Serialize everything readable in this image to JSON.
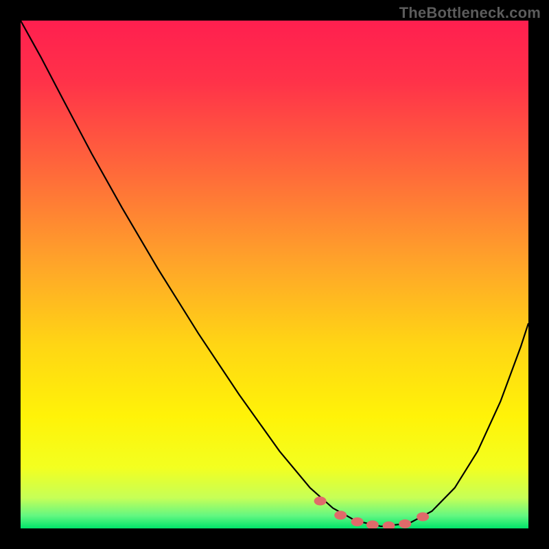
{
  "watermark": "TheBottleneck.com",
  "gradient_stops": [
    {
      "offset": 0.0,
      "color": "#ff1f4f"
    },
    {
      "offset": 0.12,
      "color": "#ff3249"
    },
    {
      "offset": 0.3,
      "color": "#ff6a3a"
    },
    {
      "offset": 0.48,
      "color": "#ffa529"
    },
    {
      "offset": 0.64,
      "color": "#ffd614"
    },
    {
      "offset": 0.78,
      "color": "#fff308"
    },
    {
      "offset": 0.88,
      "color": "#f3ff20"
    },
    {
      "offset": 0.94,
      "color": "#c6ff57"
    },
    {
      "offset": 0.975,
      "color": "#63f781"
    },
    {
      "offset": 1.0,
      "color": "#00e46a"
    }
  ],
  "curve": {
    "stroke": "#000000",
    "width": 2.2,
    "points": [
      [
        0.0,
        0.0
      ],
      [
        0.04,
        0.072
      ],
      [
        0.085,
        0.158
      ],
      [
        0.14,
        0.262
      ],
      [
        0.2,
        0.369
      ],
      [
        0.27,
        0.488
      ],
      [
        0.35,
        0.616
      ],
      [
        0.43,
        0.736
      ],
      [
        0.51,
        0.848
      ],
      [
        0.57,
        0.92
      ],
      [
        0.615,
        0.96
      ],
      [
        0.66,
        0.985
      ],
      [
        0.71,
        0.996
      ],
      [
        0.765,
        0.99
      ],
      [
        0.81,
        0.966
      ],
      [
        0.855,
        0.92
      ],
      [
        0.9,
        0.848
      ],
      [
        0.945,
        0.75
      ],
      [
        0.985,
        0.642
      ],
      [
        1.0,
        0.596
      ]
    ]
  },
  "dots": {
    "fill": "#e06a6a",
    "rx": 9,
    "ry": 6.5,
    "points": [
      [
        0.59,
        0.946
      ],
      [
        0.63,
        0.974
      ],
      [
        0.663,
        0.987
      ],
      [
        0.693,
        0.993
      ],
      [
        0.725,
        0.995
      ],
      [
        0.757,
        0.991
      ],
      [
        0.792,
        0.977
      ]
    ]
  },
  "chart_data": {
    "type": "line",
    "title": "",
    "xlabel": "",
    "ylabel": "",
    "xlim": [
      0,
      1
    ],
    "ylim": [
      0,
      1
    ],
    "series": [
      {
        "name": "bottleneck-curve",
        "x": [
          0.0,
          0.04,
          0.085,
          0.14,
          0.2,
          0.27,
          0.35,
          0.43,
          0.51,
          0.57,
          0.615,
          0.66,
          0.71,
          0.765,
          0.81,
          0.855,
          0.9,
          0.945,
          0.985,
          1.0
        ],
        "y": [
          1.0,
          0.928,
          0.842,
          0.738,
          0.631,
          0.512,
          0.384,
          0.264,
          0.152,
          0.08,
          0.04,
          0.015,
          0.004,
          0.01,
          0.034,
          0.08,
          0.152,
          0.25,
          0.358,
          0.404
        ]
      },
      {
        "name": "optimal-range-dots",
        "x": [
          0.59,
          0.63,
          0.663,
          0.693,
          0.725,
          0.757,
          0.792
        ],
        "y": [
          0.054,
          0.026,
          0.013,
          0.007,
          0.005,
          0.009,
          0.023
        ]
      }
    ],
    "annotations": [
      {
        "text": "TheBottleneck.com",
        "role": "watermark"
      }
    ]
  }
}
